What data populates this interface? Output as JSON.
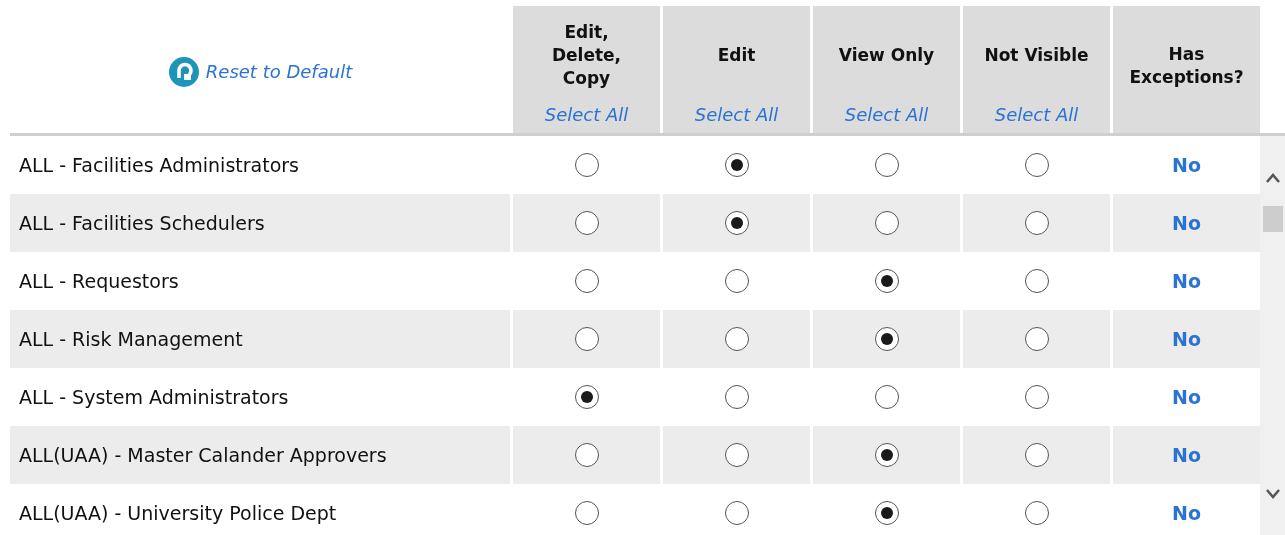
{
  "reset_link": "Reset to Default",
  "columns": [
    {
      "title": "Edit,\nDelete,\nCopy",
      "select_all": "Select All"
    },
    {
      "title": "Edit",
      "select_all": "Select All"
    },
    {
      "title": "View Only",
      "select_all": "Select All"
    },
    {
      "title": "Not Visible",
      "select_all": "Select All"
    },
    {
      "title": "Has\nExceptions?"
    }
  ],
  "rows": [
    {
      "name": "ALL - Facilities Administrators",
      "options": [
        {
          "selected": false
        },
        {
          "selected": true
        },
        {
          "selected": false
        },
        {
          "selected": false
        }
      ],
      "exceptions": "No"
    },
    {
      "name": "ALL - Facilities Schedulers",
      "options": [
        {
          "selected": false
        },
        {
          "selected": true
        },
        {
          "selected": false
        },
        {
          "selected": false
        }
      ],
      "exceptions": "No"
    },
    {
      "name": "ALL - Requestors",
      "options": [
        {
          "selected": false
        },
        {
          "selected": false
        },
        {
          "selected": true
        },
        {
          "selected": false
        }
      ],
      "exceptions": "No"
    },
    {
      "name": "ALL - Risk Management",
      "options": [
        {
          "selected": false
        },
        {
          "selected": false
        },
        {
          "selected": true
        },
        {
          "selected": false
        }
      ],
      "exceptions": "No"
    },
    {
      "name": "ALL - System Administrators",
      "options": [
        {
          "selected": true
        },
        {
          "selected": false
        },
        {
          "selected": false
        },
        {
          "selected": false
        }
      ],
      "exceptions": "No"
    },
    {
      "name": "ALL(UAA) - Master Calander Approvers",
      "options": [
        {
          "selected": false
        },
        {
          "selected": false
        },
        {
          "selected": true
        },
        {
          "selected": false
        }
      ],
      "exceptions": "No"
    },
    {
      "name": "ALL(UAA) - University Police Dept",
      "options": [
        {
          "selected": false
        },
        {
          "selected": false
        },
        {
          "selected": true
        },
        {
          "selected": false
        }
      ],
      "exceptions": "No"
    }
  ]
}
